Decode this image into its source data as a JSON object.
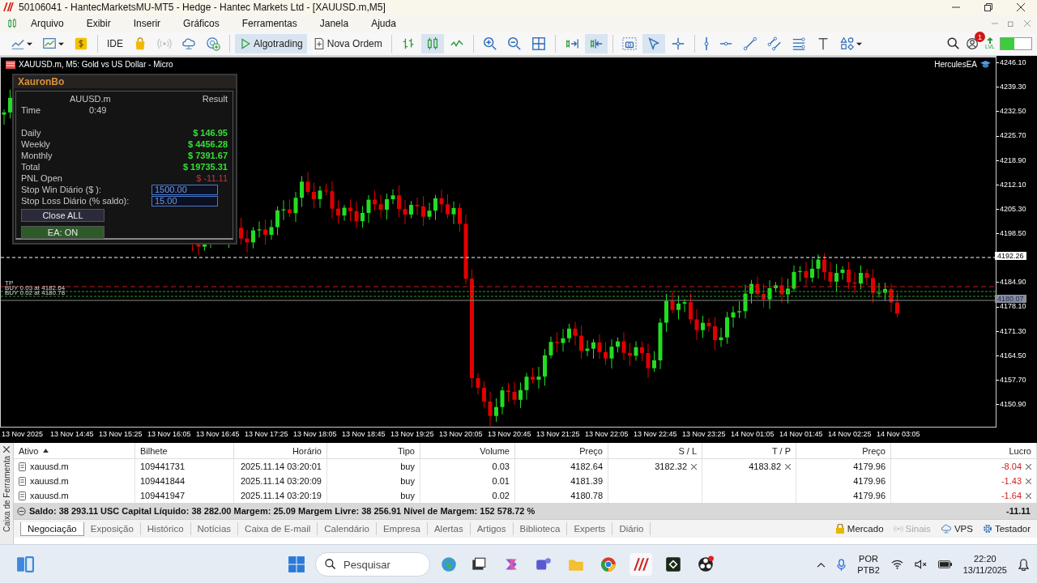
{
  "window": {
    "title": "50106041 - HantecMarketsMU-MT5 - Hedge - Hantec Markets Ltd - [XAUUSD.m,M5]"
  },
  "menu": [
    "Arquivo",
    "Exibir",
    "Inserir",
    "Gráficos",
    "Ferramentas",
    "Janela",
    "Ajuda"
  ],
  "toolbar": {
    "ide": "IDE",
    "algotrading": {
      "label": "Algotrading",
      "on": true
    },
    "new_order": "Nova Ordem",
    "chart_types": [
      {
        "kind": "bars",
        "selected": false
      },
      {
        "kind": "candles",
        "selected": true
      },
      {
        "kind": "line",
        "selected": false
      }
    ],
    "autoscroll": {
      "on": false
    },
    "chart_shift": {
      "on": true
    },
    "cursor_tools": [
      {
        "kind": "cursor",
        "selected": true
      },
      {
        "kind": "crosshair",
        "selected": false
      }
    ],
    "notifications": "1",
    "lvl": "LVL"
  },
  "chart": {
    "title": "XAUUSD.m, M5:  Gold vs US Dollar - Micro",
    "ea_name": "HerculesEA",
    "y_labels": [
      "4246.10",
      "4239.30",
      "4232.50",
      "4225.70",
      "4218.90",
      "4212.10",
      "4205.30",
      "4198.50",
      "4184.90",
      "4178.10",
      "4171.30",
      "4164.50",
      "4157.70",
      "4150.90"
    ],
    "price_tags": [
      {
        "kind": "bid",
        "text": "4192.26"
      },
      {
        "kind": "position",
        "text": "4180.07"
      }
    ],
    "trade_labels": [
      "TP",
      "BUY 0.03 at 4182.64",
      "BUY 0.02 at 4180.78"
    ],
    "x_labels": [
      "13 Nov 2025",
      "13 Nov 14:45",
      "13 Nov 15:25",
      "13 Nov 16:05",
      "13 Nov 16:45",
      "13 Nov 17:25",
      "13 Nov 18:05",
      "13 Nov 18:45",
      "13 Nov 19:25",
      "13 Nov 20:05",
      "13 Nov 20:45",
      "13 Nov 21:25",
      "13 Nov 22:05",
      "13 Nov 22:45",
      "13 Nov 23:25",
      "14 Nov 01:05",
      "14 Nov 01:45",
      "14 Nov 02:25",
      "14 Nov 03:05"
    ],
    "panel": {
      "title": "XauronBo",
      "symbol": "AUUSD.m",
      "result_label": "Result",
      "time_label": "Time",
      "time": "0:49",
      "rows": [
        {
          "label": "Daily",
          "value": "$ 146.95",
          "kind": "gain"
        },
        {
          "label": "Weekly",
          "value": "$ 4456.28",
          "kind": "gain"
        },
        {
          "label": "Monthly",
          "value": "$ 7391.67",
          "kind": "gain"
        },
        {
          "label": "Total",
          "value": "$ 19735.31",
          "kind": "gain"
        },
        {
          "label": "PNL Open",
          "value": "$ -11.11",
          "kind": "loss"
        }
      ],
      "inputs": [
        {
          "label": "Stop Win Diário ($ ):",
          "value": "1500.00"
        },
        {
          "label": "Stop Loss Diário (% saldo):",
          "value": "15.00"
        }
      ],
      "close_button": "Close ALL",
      "ea_button": {
        "label": "EA: ON",
        "on": true
      }
    }
  },
  "toolbox": {
    "title": "Caixa de Ferramenta"
  },
  "table": {
    "columns": [
      "Ativo",
      "Bilhete",
      "Horário",
      "Tipo",
      "Volume",
      "Preço",
      "S / L",
      "T / P",
      "Preço",
      "Lucro"
    ],
    "rows": [
      {
        "symbol": "xauusd.m",
        "ticket": "109441731",
        "time": "2025.11.14 03:20:01",
        "type": "buy",
        "volume": "0.03",
        "price": "4182.64",
        "sl": "3182.32",
        "tp": "4183.82",
        "current": "4179.96",
        "profit": "-8.04"
      },
      {
        "symbol": "xauusd.m",
        "ticket": "109441844",
        "time": "2025.11.14 03:20:09",
        "type": "buy",
        "volume": "0.01",
        "price": "4181.39",
        "current": "4179.96",
        "profit": "-1.43"
      },
      {
        "symbol": "xauusd.m",
        "ticket": "109441947",
        "time": "2025.11.14 03:20:19",
        "type": "buy",
        "volume": "0.02",
        "price": "4180.78",
        "current": "4179.96",
        "profit": "-1.64"
      }
    ],
    "summary": "Saldo: 38 293.11 USC  Capital Líquido: 38 282.00  Margem: 25.09  Margem Livre: 38 256.91  Nível de Margem: 152 578.72 %",
    "total": "-11.11"
  },
  "tabs": [
    {
      "label": "Negociação",
      "selected": true
    },
    {
      "label": "Exposição",
      "selected": false
    },
    {
      "label": "Histórico",
      "selected": false
    },
    {
      "label": "Notícias",
      "selected": false
    },
    {
      "label": "Caixa de E-mail",
      "selected": false
    },
    {
      "label": "Calendário",
      "selected": false
    },
    {
      "label": "Empresa",
      "selected": false
    },
    {
      "label": "Alertas",
      "selected": false
    },
    {
      "label": "Artigos",
      "selected": false
    },
    {
      "label": "Biblioteca",
      "selected": false
    },
    {
      "label": "Experts",
      "selected": false
    },
    {
      "label": "Diário",
      "selected": false
    }
  ],
  "status": [
    {
      "kind": "market",
      "label": "Mercado",
      "disabled": false
    },
    {
      "kind": "signals",
      "label": "Sinais",
      "disabled": true
    },
    {
      "kind": "vps",
      "label": "VPS",
      "disabled": false
    },
    {
      "kind": "tester",
      "label": "Testador",
      "disabled": false
    }
  ],
  "taskbar": {
    "search_placeholder": "Pesquisar",
    "language": [
      "POR",
      "PTB2"
    ],
    "time": "22:20",
    "date": "13/11/2025"
  }
}
